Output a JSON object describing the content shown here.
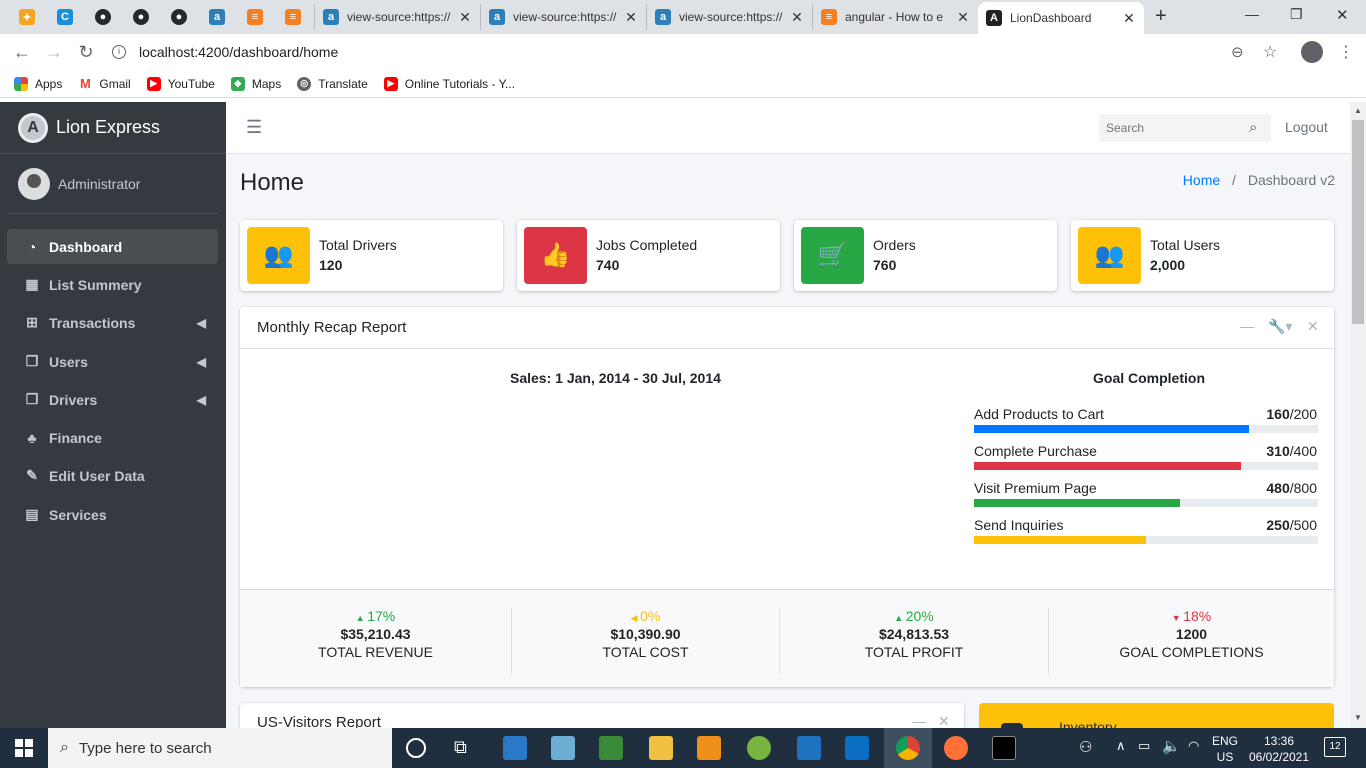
{
  "browser": {
    "tabs": [
      {
        "label": "view-source:https://",
        "icon": "a-icon"
      },
      {
        "label": "view-source:https://",
        "icon": "a-icon"
      },
      {
        "label": "view-source:https://",
        "icon": "a-icon"
      },
      {
        "label": "angular - How to e",
        "icon": "stackoverflow-icon"
      },
      {
        "label": "LionDashboard",
        "icon": "angular-icon",
        "active": true
      }
    ],
    "url": "localhost:4200/dashboard/home",
    "bookmarks": [
      "Apps",
      "Gmail",
      "YouTube",
      "Maps",
      "Translate",
      "Online Tutorials - Y..."
    ]
  },
  "sidebar": {
    "brand": "Lion Express",
    "user": "Administrator",
    "items": [
      {
        "label": "Dashboard",
        "icon": "tachometer-icon",
        "active": true,
        "chevron": false
      },
      {
        "label": "List Summery",
        "icon": "th-icon",
        "chevron": false
      },
      {
        "label": "Transactions",
        "icon": "table-icon",
        "chevron": true
      },
      {
        "label": "Users",
        "icon": "copy-icon",
        "chevron": true
      },
      {
        "label": "Drivers",
        "icon": "copy-icon",
        "chevron": true
      },
      {
        "label": "Finance",
        "icon": "tree-icon",
        "chevron": false
      },
      {
        "label": "Edit User Data",
        "icon": "edit-icon",
        "chevron": false
      },
      {
        "label": "Services",
        "icon": "calendar-icon",
        "chevron": false
      }
    ]
  },
  "topnav": {
    "search_placeholder": "Search",
    "logout": "Logout"
  },
  "page": {
    "title": "Home",
    "breadcrumb_home": "Home",
    "breadcrumb_current": "Dashboard v2"
  },
  "info_boxes": [
    {
      "label": "Total Drivers",
      "value": "120",
      "color": "#ffc107",
      "icon": "users-icon"
    },
    {
      "label": "Jobs Completed",
      "value": "740",
      "color": "#dc3545",
      "icon": "thumbs-up-icon"
    },
    {
      "label": "Orders",
      "value": "760",
      "color": "#28a745",
      "icon": "shopping-cart-icon"
    },
    {
      "label": "Total Users",
      "value": "2,000",
      "color": "#ffc107",
      "icon": "users-icon"
    }
  ],
  "recap": {
    "title": "Monthly Recap Report",
    "sales_title": "Sales: 1 Jan, 2014 - 30 Jul, 2014",
    "goal_title": "Goal Completion",
    "goals": [
      {
        "label": "Add Products to Cart",
        "value": "160",
        "total": "/200",
        "fraction": 0.8,
        "color": "#007bff"
      },
      {
        "label": "Complete Purchase",
        "value": "310",
        "total": "/400",
        "fraction": 0.775,
        "color": "#dc3545"
      },
      {
        "label": "Visit Premium Page",
        "value": "480",
        "total": "/800",
        "fraction": 0.6,
        "color": "#28a745"
      },
      {
        "label": "Send Inquiries",
        "value": "250",
        "total": "/500",
        "fraction": 0.5,
        "color": "#ffc107"
      }
    ],
    "stats": [
      {
        "pct": "17%",
        "arrow": "▲",
        "color": "#28a745",
        "amount": "$35,210.43",
        "label": "TOTAL REVENUE"
      },
      {
        "pct": "0%",
        "arrow": "◀",
        "color": "#ffc107",
        "amount": "$10,390.90",
        "label": "TOTAL COST"
      },
      {
        "pct": "20%",
        "arrow": "▲",
        "color": "#28a745",
        "amount": "$24,813.53",
        "label": "TOTAL PROFIT"
      },
      {
        "pct": "18%",
        "arrow": "▼",
        "color": "#dc3545",
        "amount": "1200",
        "label": "GOAL COMPLETIONS"
      }
    ]
  },
  "visitors": {
    "title": "US-Visitors Report"
  },
  "inventory": {
    "title": "Inventory"
  },
  "taskbar": {
    "search": "Type here to search",
    "lang": "ENG",
    "region": "US",
    "time": "13:36",
    "date": "06/02/2021",
    "notifications": "12"
  }
}
